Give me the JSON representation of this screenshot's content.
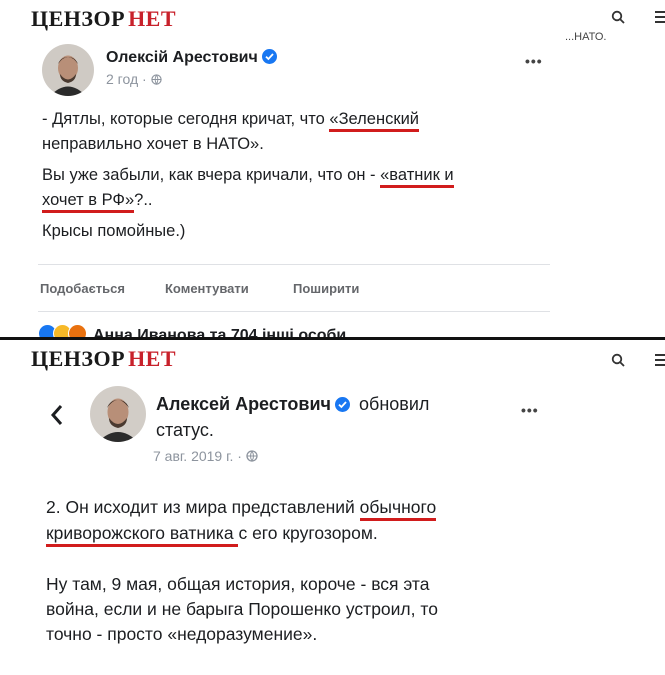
{
  "brand": {
    "part1": "ЦЕНЗОР",
    "part2": "НЕТ"
  },
  "colors": {
    "brand_red": "#c8212b",
    "underline_red": "#d11c1c",
    "verified_blue": "#1877f2"
  },
  "icons": [
    "search-icon",
    "menu-icon",
    "verified-icon",
    "globe-icon",
    "more-icon",
    "back-icon"
  ],
  "post1": {
    "cut_text": "...НАТО.",
    "author": "Олексій Арестович",
    "time": "2 год · ",
    "more": "•••",
    "lines": {
      "l1_a": "- Дятлы, которые сегодня кричат, что ",
      "l1_b": "«Зеленский",
      "l2": "неправильно хочет в НАТО».",
      "l3_a": "Вы уже забыли, как вчера кричали, что он - ",
      "l3_b": "«ватник и",
      "l4_a": "хочет в РФ»",
      "l4_b": "?..",
      "l5": "Крысы помойные.)"
    },
    "actions": {
      "like": "Подобається",
      "comment": "Коментувати",
      "share": "Поширити"
    },
    "reactions_text": "Анна Иванова та 704 інші особи"
  },
  "post2": {
    "author": "Алексей Арестович",
    "updated": "обновил",
    "status": "статус.",
    "date": "7 авг. 2019 г. · ",
    "more": "•••",
    "lines": {
      "l1_a": "2. Он исходит из мира представлений ",
      "l1_b": "обычного",
      "l2_a": "криворожского ватника ",
      "l2_b": "с его кругозором.",
      "l3": "Ну там, 9 мая, общая история, короче - вся эта",
      "l4": "война, если и не барыга Порошенко устроил, то",
      "l5": "точно - просто «недоразумение»."
    }
  }
}
